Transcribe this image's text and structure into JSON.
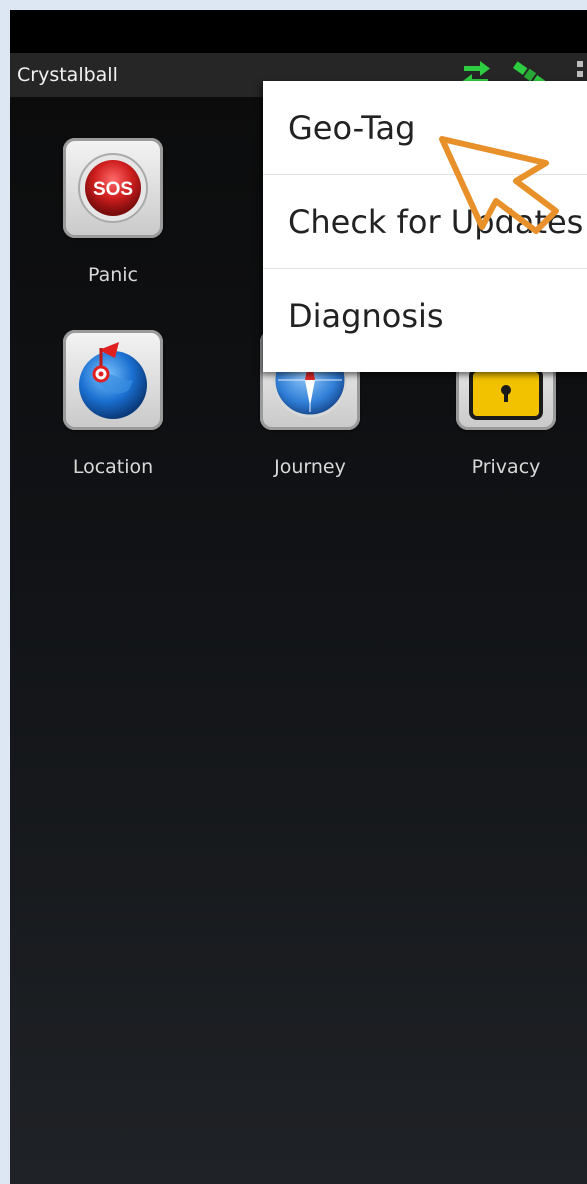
{
  "app": {
    "title": "Crystalball"
  },
  "action_bar_icons": [
    "sync-icon",
    "satellite-icon",
    "overflow-menu-icon"
  ],
  "grid": [
    {
      "label": "Panic",
      "icon": "sos-icon"
    },
    {
      "label": "Location",
      "icon": "globe-pin-icon"
    },
    {
      "label": "Journey",
      "icon": "compass-icon"
    },
    {
      "label": "Privacy",
      "icon": "lock-icon"
    }
  ],
  "icon_text": {
    "sos": "SOS"
  },
  "menu": {
    "items": [
      {
        "label": "Geo-Tag"
      },
      {
        "label": "Check for Updates"
      },
      {
        "label": "Diagnosis"
      }
    ]
  },
  "colors": {
    "status_bar": "#000000",
    "action_bar": "#262626",
    "accent_green": "#2ecc40",
    "cursor_orange": "#e8902a",
    "sos_red": "#d01f1f"
  }
}
